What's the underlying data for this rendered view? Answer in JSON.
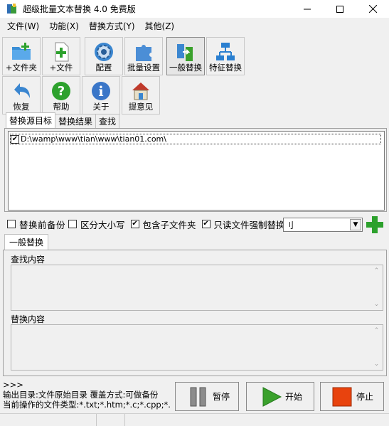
{
  "window": {
    "title": "超级批量文本替换 4.0 免费版",
    "min": "—",
    "max": "☐",
    "close": "✕"
  },
  "menu": [
    "文件(W)",
    "功能(X)",
    "替换方式(Y)",
    "其他(Z)"
  ],
  "toolbar": {
    "add_folder": "+文件夹",
    "add_file": "+文件",
    "config": "配置",
    "batch_settings": "批量设置",
    "general_replace": "一般替换",
    "feature_replace": "特征替换",
    "restore": "恢复",
    "help": "帮助",
    "about": "关于",
    "feedback": "提意见"
  },
  "source_tabs": [
    "替换源目标",
    "替换结果",
    "查找"
  ],
  "source_list": [
    {
      "checked": true,
      "path": "D:\\wamp\\www\\tian\\www\\tian01.com\\"
    }
  ],
  "options": {
    "backup": {
      "label": "替换前备份",
      "checked": false
    },
    "case": {
      "label": "区分大小写",
      "checked": false
    },
    "subfolders": {
      "label": "包含子文件夹",
      "checked": true
    },
    "readonly": {
      "label": "只读文件强制替换",
      "checked": true
    },
    "combo_value": "刂"
  },
  "ops_tab": "一般替换",
  "find_label": "查找内容",
  "replace_label": "替换内容",
  "status_lines": [
    ">>>",
    "输出目录:文件原始目录     覆盖方式:可做备份",
    "当前操作的文件类型:*.txt;*.htm;*.c;*.cpp;*.h;*.h"
  ],
  "buttons": {
    "pause": "暂停",
    "start": "开始",
    "stop": "停止"
  },
  "colors": {
    "start_green": "#3aa12c",
    "stop_orange": "#e8430e",
    "pause_gray": "#8c8c8c"
  }
}
